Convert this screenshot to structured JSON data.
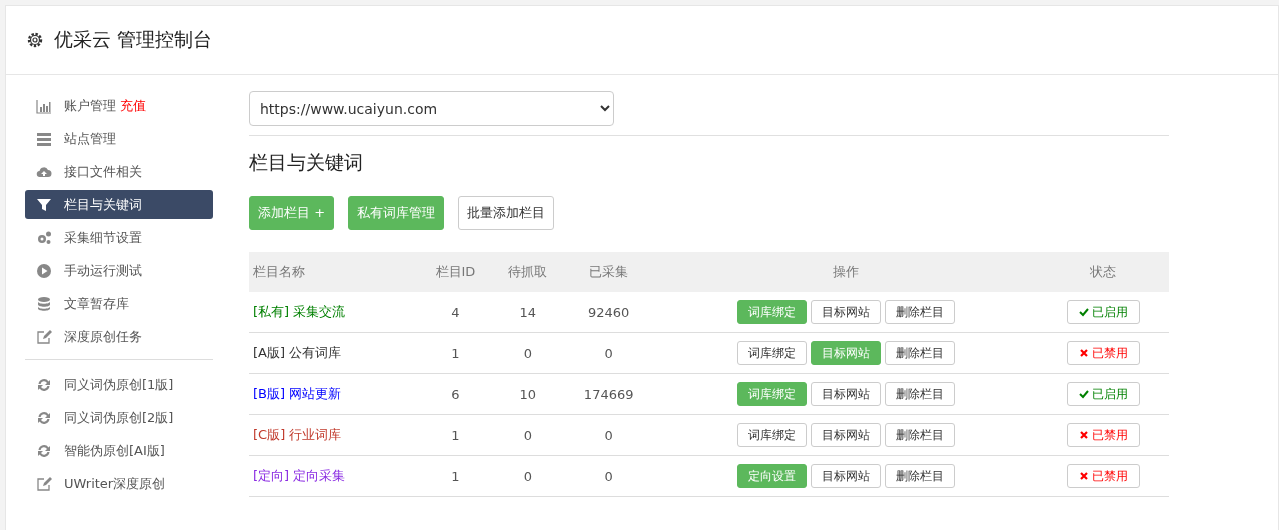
{
  "header": {
    "title": "优采云 管理控制台"
  },
  "sidebar": {
    "items": [
      {
        "label": "账户管理",
        "badge": "充值",
        "kind": "chart",
        "selected": false
      },
      {
        "label": "站点管理",
        "kind": "server",
        "selected": false
      },
      {
        "label": "接口文件相关",
        "kind": "cloud",
        "selected": false
      },
      {
        "label": "栏目与关键词",
        "kind": "filter",
        "selected": true
      },
      {
        "label": "采集细节设置",
        "kind": "gears",
        "selected": false
      },
      {
        "label": "手动运行测试",
        "kind": "play",
        "selected": false
      },
      {
        "label": "文章暂存库",
        "kind": "database",
        "selected": false
      },
      {
        "label": "深度原创任务",
        "kind": "edit",
        "selected": false
      },
      {
        "kind": "divider"
      },
      {
        "label": "同义词伪原创[1版]",
        "kind": "refresh",
        "selected": false
      },
      {
        "label": "同义词伪原创[2版]",
        "kind": "refresh",
        "selected": false
      },
      {
        "label": "智能伪原创[AI版]",
        "kind": "refresh",
        "selected": false
      },
      {
        "label": "UWriter深度原创",
        "kind": "edit",
        "selected": false
      }
    ]
  },
  "site_select": {
    "value": "https://www.ucaiyun.com"
  },
  "section_title": "栏目与关键词",
  "toolbar": [
    {
      "label": "添加栏目 +",
      "primary": true
    },
    {
      "label": "私有词库管理",
      "primary": true
    },
    {
      "label": "批量添加栏目",
      "primary": false
    }
  ],
  "table": {
    "columns": [
      "栏目名称",
      "栏目ID",
      "待抓取",
      "已采集",
      "操作",
      "状态"
    ],
    "rows": [
      {
        "tag": "[私有]",
        "name": "采集交流",
        "color": "#008000",
        "id": "4",
        "pending": "14",
        "collected": "92460",
        "actions": [
          {
            "label": "词库绑定",
            "active": true
          },
          {
            "label": "目标网站",
            "active": false
          },
          {
            "label": "删除栏目",
            "active": false
          }
        ],
        "status": "已启用",
        "enabled": true
      },
      {
        "tag": "[A版]",
        "name": "公有词库",
        "color": "#333333",
        "id": "1",
        "pending": "0",
        "collected": "0",
        "actions": [
          {
            "label": "词库绑定",
            "active": false
          },
          {
            "label": "目标网站",
            "active": true
          },
          {
            "label": "删除栏目",
            "active": false
          }
        ],
        "status": "已禁用",
        "enabled": false
      },
      {
        "tag": "[B版]",
        "name": "网站更新",
        "color": "#0000ff",
        "id": "6",
        "pending": "10",
        "collected": "174669",
        "actions": [
          {
            "label": "词库绑定",
            "active": true
          },
          {
            "label": "目标网站",
            "active": false
          },
          {
            "label": "删除栏目",
            "active": false
          }
        ],
        "status": "已启用",
        "enabled": true
      },
      {
        "tag": "[C版]",
        "name": "行业词库",
        "color": "#c0392b",
        "id": "1",
        "pending": "0",
        "collected": "0",
        "actions": [
          {
            "label": "词库绑定",
            "active": false
          },
          {
            "label": "目标网站",
            "active": false
          },
          {
            "label": "删除栏目",
            "active": false
          }
        ],
        "status": "已禁用",
        "enabled": false
      },
      {
        "tag": "[定向]",
        "name": "定向采集",
        "color": "#8a2be2",
        "id": "1",
        "pending": "0",
        "collected": "0",
        "actions": [
          {
            "label": "定向设置",
            "active": true
          },
          {
            "label": "目标网站",
            "active": false
          },
          {
            "label": "删除栏目",
            "active": false
          }
        ],
        "status": "已禁用",
        "enabled": false
      }
    ]
  }
}
